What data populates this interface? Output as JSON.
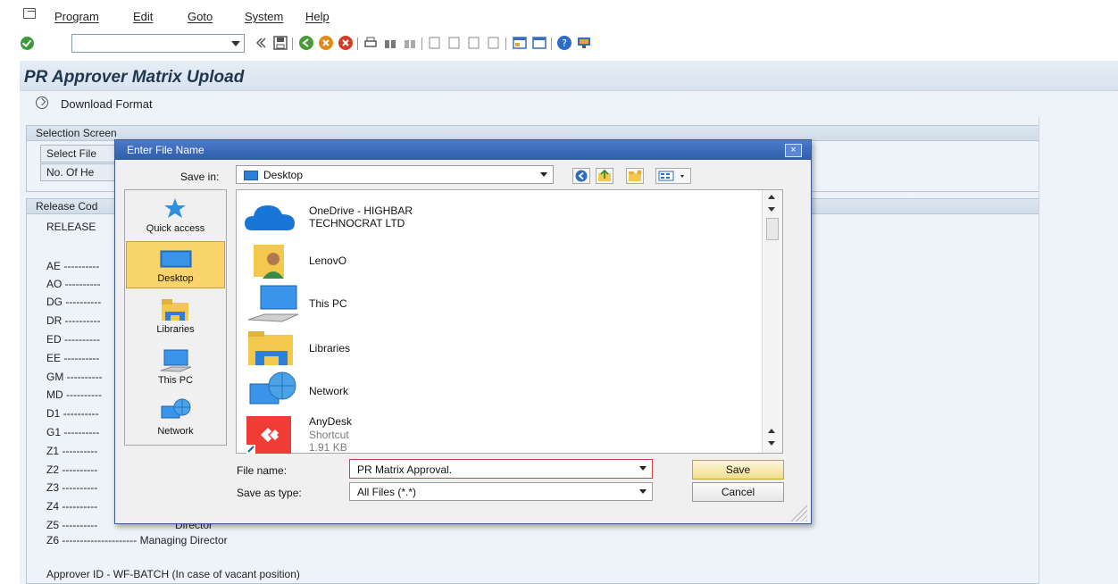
{
  "menu": {
    "items": [
      "Program",
      "Edit",
      "Goto",
      "System",
      "Help"
    ]
  },
  "toolbar": {
    "command_value": ""
  },
  "page": {
    "title": "PR Approver Matrix Upload",
    "download_label": "Download Format"
  },
  "selection": {
    "header": "Selection Screen",
    "select_file_label": "Select File",
    "headers_label": "No. Of He"
  },
  "release": {
    "header": "Release Cod",
    "heading": "RELEASE",
    "codes": [
      "AE ----------",
      "AO ----------",
      "DG ----------",
      "DR ----------",
      "ED ----------",
      "EE ----------",
      "GM ----------",
      "MD ----------",
      "D1 ----------",
      "G1 ----------",
      "Z1 ----------",
      "Z2 ----------",
      "Z3 ----------",
      "Z4 ----------",
      "Z5 ----------"
    ],
    "z5_text": "Director",
    "z6_line": "Z6 --------------------- Managing Director",
    "approver_line": "Approver ID - WF-BATCH (In case of vacant position)"
  },
  "dialog": {
    "title": "Enter File Name",
    "close_glyph": "×",
    "save_in_label": "Save in:",
    "save_in_value": "Desktop",
    "places": [
      {
        "label": "Quick access"
      },
      {
        "label": "Desktop"
      },
      {
        "label": "Libraries"
      },
      {
        "label": "This PC"
      },
      {
        "label": "Network"
      }
    ],
    "files": [
      {
        "name": "OneDrive - HIGHBAR",
        "name2": "TECHNOCRAT LTD"
      },
      {
        "name": "LenovO"
      },
      {
        "name": "This PC"
      },
      {
        "name": "Libraries"
      },
      {
        "name": "Network"
      },
      {
        "name": "AnyDesk",
        "sub1": "Shortcut",
        "sub2": "1.91 KB"
      }
    ],
    "file_name_label": "File name:",
    "file_name_value": "PR Matrix Approval.",
    "save_type_label": "Save as type:",
    "save_type_value": "All Files (*.*)",
    "save_label": "Save",
    "cancel_label": "Cancel"
  },
  "colors": {
    "title_blue": "#2f5cab",
    "selected_place": "#f9d46a",
    "sap_background": "#eef3f9"
  }
}
